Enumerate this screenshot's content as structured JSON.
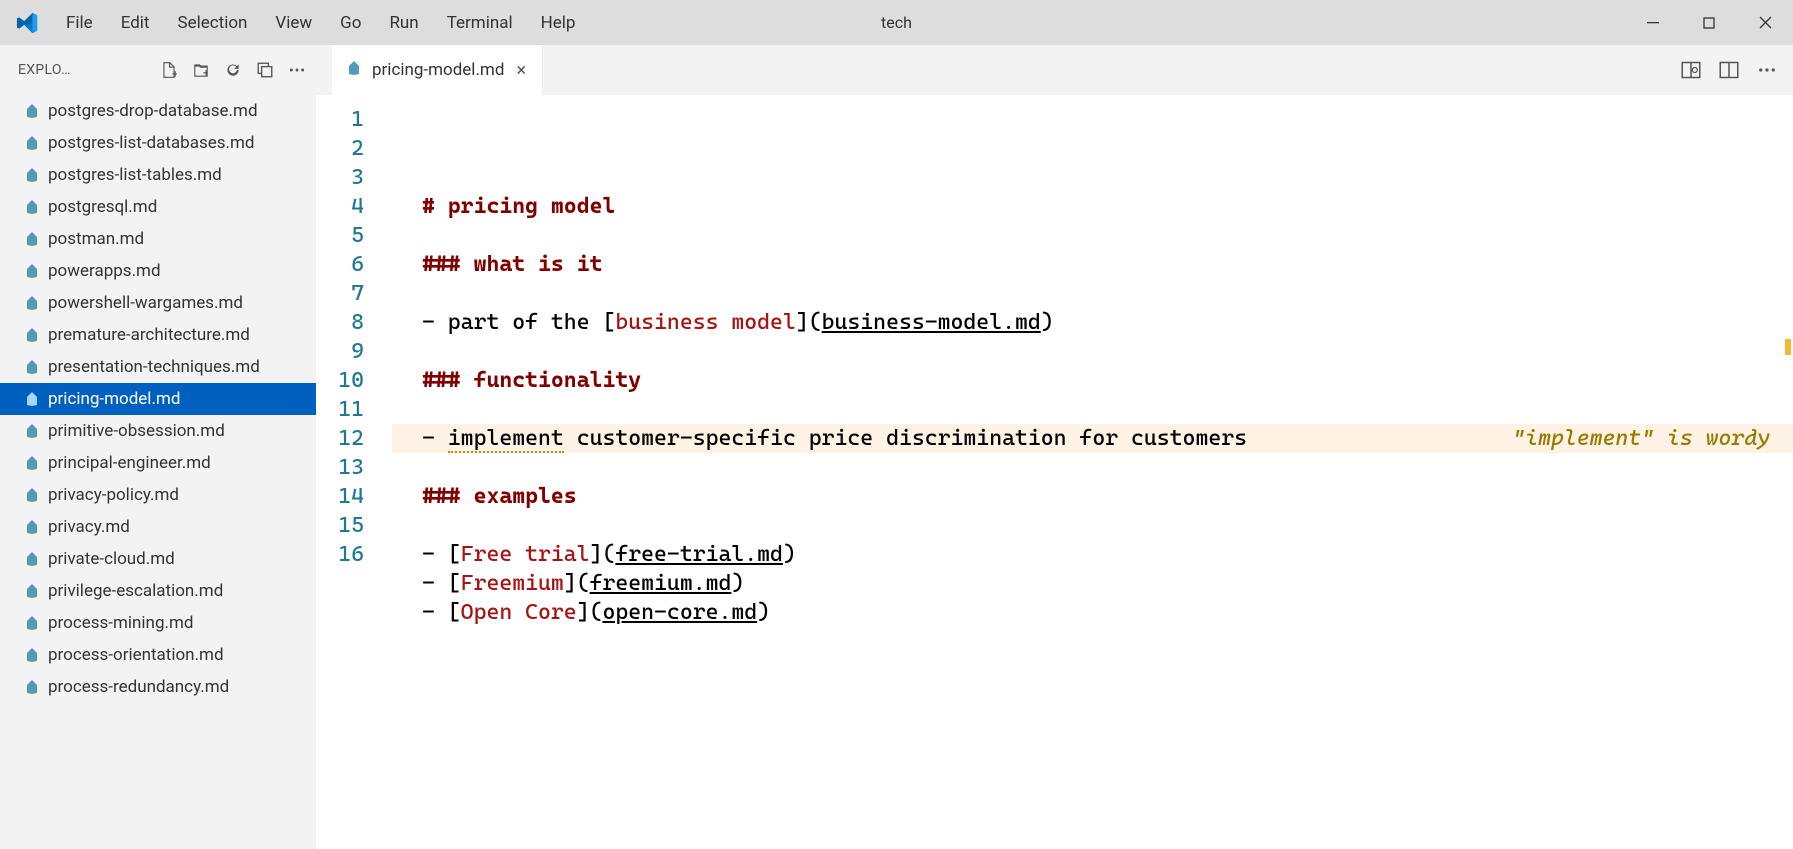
{
  "titlebar": {
    "app_title": "tech",
    "menu": [
      "File",
      "Edit",
      "Selection",
      "View",
      "Go",
      "Run",
      "Terminal",
      "Help"
    ]
  },
  "explorer": {
    "title": "EXPLO…",
    "files": [
      "postgres-drop-database.md",
      "postgres-list-databases.md",
      "postgres-list-tables.md",
      "postgresql.md",
      "postman.md",
      "powerapps.md",
      "powershell-wargames.md",
      "premature-architecture.md",
      "presentation-techniques.md",
      "pricing-model.md",
      "primitive-obsession.md",
      "principal-engineer.md",
      "privacy-policy.md",
      "privacy.md",
      "private-cloud.md",
      "privilege-escalation.md",
      "process-mining.md",
      "process-orientation.md",
      "process-redundancy.md"
    ],
    "active_index": 9
  },
  "tab": {
    "filename": "pricing-model.md"
  },
  "editor": {
    "lines": [
      {
        "type": "h1",
        "hash": "# ",
        "text": "pricing model"
      },
      {
        "type": "blank"
      },
      {
        "type": "h3",
        "hash": "### ",
        "text": "what is it"
      },
      {
        "type": "blank"
      },
      {
        "type": "link-line",
        "prefix": "- part of the [",
        "link_text": "business model",
        "mid": "](",
        "link_url": "business-model.md",
        "suffix": ")"
      },
      {
        "type": "blank"
      },
      {
        "type": "h3",
        "hash": "### ",
        "text": "functionality"
      },
      {
        "type": "blank"
      },
      {
        "type": "warn-line",
        "prefix": "- ",
        "warn_word": "implement",
        "rest": " customer-specific price discrimination for customers",
        "hint": "\"implement\" is wordy "
      },
      {
        "type": "blank"
      },
      {
        "type": "h3",
        "hash": "### ",
        "text": "examples"
      },
      {
        "type": "blank"
      },
      {
        "type": "link-line",
        "prefix": "- [",
        "link_text": "Free trial",
        "mid": "](",
        "link_url": "free-trial.md",
        "suffix": ")"
      },
      {
        "type": "link-line",
        "prefix": "- [",
        "link_text": "Freemium",
        "mid": "](",
        "link_url": "freemium.md",
        "suffix": ")"
      },
      {
        "type": "link-line",
        "prefix": "- [",
        "link_text": "Open Core",
        "mid": "](",
        "link_url": "open-core.md",
        "suffix": ")"
      },
      {
        "type": "blank"
      }
    ]
  }
}
